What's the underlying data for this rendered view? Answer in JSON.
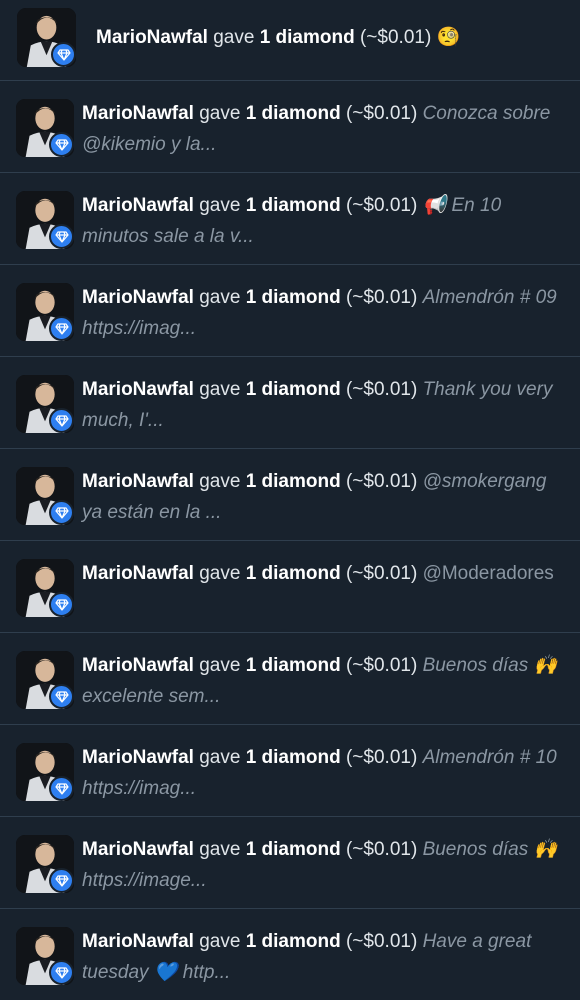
{
  "feed": {
    "items": [
      {
        "name": "MarioNawfal",
        "gave": "gave",
        "amount": "1 diamond",
        "price": "(~$0.01)",
        "message": "🧐"
      },
      {
        "name": "MarioNawfal",
        "gave": "gave",
        "amount": "1 diamond",
        "price": "(~$0.01)",
        "message": "Conozca sobre @kikemio y la..."
      },
      {
        "name": "MarioNawfal",
        "gave": "gave",
        "amount": "1 diamond",
        "price": "(~$0.01)",
        "message": "📢 En 10 minutos sale a la v..."
      },
      {
        "name": "MarioNawfal",
        "gave": "gave",
        "amount": "1 diamond",
        "price": "(~$0.01)",
        "message": "Almendrón # 09 https://imag..."
      },
      {
        "name": "MarioNawfal",
        "gave": "gave",
        "amount": "1 diamond",
        "price": "(~$0.01)",
        "message": "Thank you very much, I'..."
      },
      {
        "name": "MarioNawfal",
        "gave": "gave",
        "amount": "1 diamond",
        "price": "(~$0.01)",
        "message": "@smokergang ya están en la ..."
      },
      {
        "name": "MarioNawfal",
        "gave": "gave",
        "amount": "1 diamond",
        "price": "(~$0.01)",
        "message": "@Moderadores"
      },
      {
        "name": "MarioNawfal",
        "gave": "gave",
        "amount": "1 diamond",
        "price": "(~$0.01)",
        "message": "Buenos días 🙌 excelente sem..."
      },
      {
        "name": "MarioNawfal",
        "gave": "gave",
        "amount": "1 diamond",
        "price": "(~$0.01)",
        "message": "Almendrón # 10 https://imag..."
      },
      {
        "name": "MarioNawfal",
        "gave": "gave",
        "amount": "1 diamond",
        "price": "(~$0.01)",
        "message": "Buenos días 🙌 https://image..."
      },
      {
        "name": "MarioNawfal",
        "gave": "gave",
        "amount": "1 diamond",
        "price": "(~$0.01)",
        "message": "Have a great tuesday 💙 http..."
      }
    ]
  },
  "icons": {
    "avatar": "profile-photo",
    "badge": "diamond-icon"
  },
  "colors": {
    "background": "#15202b",
    "row_background": "#18222d",
    "divider": "#2f3e4d",
    "text_primary": "#ffffff",
    "text_secondary": "#8b97a3",
    "badge": "#2e7ff0"
  }
}
